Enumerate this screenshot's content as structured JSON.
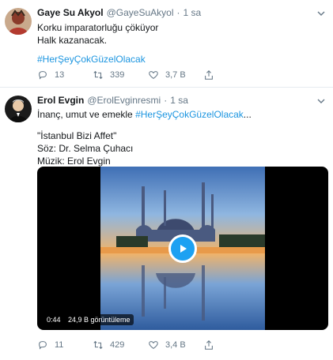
{
  "tweets": [
    {
      "author_name": "Gaye Su Akyol",
      "handle": "@GayeSuAkyol",
      "separator": "·",
      "time": "1 sa",
      "lines": [
        "Korku imparatorluğu çöküyor",
        "Halk kazanacak."
      ],
      "hashtag": "#HerŞeyÇokGüzelOlacak",
      "replies": "13",
      "retweets": "339",
      "likes": "3,7 B"
    },
    {
      "author_name": "Erol Evgin",
      "handle": "@ErolEvginresmi",
      "separator": "·",
      "time": "1 sa",
      "line1_prefix": "İnanç, umut ve emekle ",
      "line1_hashtag": "#HerŞeyÇokGüzelOlacak",
      "line1_suffix": "...",
      "quote_lines": [
        "\"İstanbul Bizi Affet\"",
        "Söz: Dr. Selma Çuhacı",
        "Müzik: Erol Evgin"
      ],
      "video": {
        "duration": "0:44",
        "views": "24,9 B görüntüleme"
      },
      "replies": "11",
      "retweets": "429",
      "likes": "3,4 B"
    }
  ],
  "icons": {
    "reply": "reply-icon",
    "retweet": "retweet-icon",
    "like": "heart-icon",
    "share": "share-icon",
    "caret": "chevron-down-icon",
    "play": "play-icon"
  },
  "colors": {
    "hashtag": "#1b95e0",
    "muted": "#657786",
    "divider": "#e6ecf0",
    "play": "#1da1f2"
  }
}
